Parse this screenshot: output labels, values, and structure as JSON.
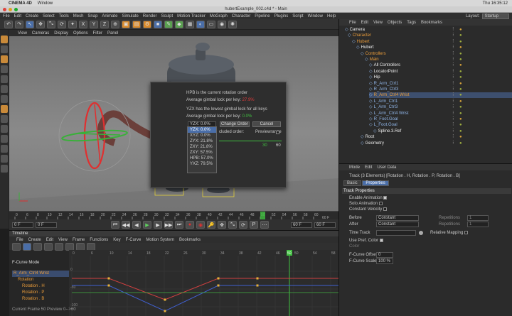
{
  "mac_bar": {
    "app": "CINEMA 4D",
    "menu": "Window",
    "clock": "Thu 16:35:12"
  },
  "title": "hubertExample_002.c4d * - Main",
  "menu": [
    "File",
    "Edit",
    "Create",
    "Select",
    "Tools",
    "Mesh",
    "Snap",
    "Animate",
    "Simulate",
    "Render",
    "Sculpt",
    "Motion Tracker",
    "MoGraph",
    "Character",
    "Pipeline",
    "Plugins",
    "Script",
    "Window",
    "Help"
  ],
  "layout": {
    "label": "Layout:",
    "value": "Startup"
  },
  "viewport_menu": [
    "View",
    "Cameras",
    "Display",
    "Options",
    "Filter",
    "Panel"
  ],
  "popup": {
    "line1": "HPB is the current rotation order",
    "line2_label": "Average gimbal lock per key: ",
    "line2_value": "27.9%",
    "line3": "YZX has the lowest gimbal lock for all keys",
    "line4_label": "Average gimbal lock per key: ",
    "line4_value": "0.0%",
    "select_value": "YZX: 0.0%",
    "change_order": "Change Order",
    "cancel": "Cancel",
    "include_text": "cluded order:",
    "preview_text": "Previewrange",
    "range_a": "30",
    "range_b": "60",
    "options": [
      "YZX: 0.0%",
      "XYZ: 0.0%",
      "ZYX: 21.8%",
      "ZXY: 21.8%",
      "ZXY: 57.5%",
      "HPB: 57.0%",
      "YXZ: 79.5%"
    ]
  },
  "ruler": {
    "ticks": [
      "0",
      "6",
      "8",
      "10",
      "12",
      "14",
      "16",
      "18",
      "20",
      "22",
      "24",
      "26",
      "28",
      "30",
      "32",
      "34",
      "36",
      "38",
      "40",
      "42",
      "44",
      "46",
      "48",
      "50",
      "52",
      "54",
      "56",
      "58",
      "60"
    ],
    "end": "60 F"
  },
  "anim": {
    "current": "0 F",
    "start": "0 F",
    "end": "60 F",
    "max": "60 F"
  },
  "timeline": {
    "title": "Timeline",
    "menu": [
      "File",
      "Create",
      "Edit",
      "View",
      "Frame",
      "Functions",
      "Key",
      "F-Curve",
      "Motion System",
      "Bookmarks"
    ],
    "mode": "F-Curve Mode",
    "tracks": [
      "R_Arm_Ctrl4 Wrist",
      "Rotation",
      "Rotation . H",
      "Rotation . P",
      "Rotation . B"
    ],
    "ticks": [
      "0",
      "6",
      "10",
      "14",
      "18",
      "22",
      "26",
      "30",
      "34",
      "38",
      "42",
      "46",
      "50",
      "54",
      "58"
    ],
    "playhead": "50",
    "yticks": [
      "0",
      "-50",
      "-100"
    ],
    "status": "Current Frame 50  Preview 0-->60"
  },
  "objects": {
    "menu": [
      "File",
      "Edit",
      "View",
      "Objects",
      "Tags",
      "Bookmarks"
    ],
    "items": [
      {
        "name": "Camera",
        "color": "white"
      },
      {
        "name": "Character",
        "color": "orange"
      },
      {
        "name": "Hubert",
        "color": "orange"
      },
      {
        "name": "Hubert",
        "color": "white"
      },
      {
        "name": "Controllers",
        "color": "orange"
      },
      {
        "name": "Main",
        "color": "orange"
      },
      {
        "name": "All Controllers",
        "color": "white"
      },
      {
        "name": "LocatorPoint",
        "color": "white"
      },
      {
        "name": "Hip",
        "color": "white"
      },
      {
        "name": "R_Arm_Ctrl1",
        "color": "blue"
      },
      {
        "name": "R_Arm_Ctrl3",
        "color": "blue"
      },
      {
        "name": "R_Arm_Ctrl4 Wrist",
        "color": "orange"
      },
      {
        "name": "L_Arm_Ctrl1",
        "color": "blue"
      },
      {
        "name": "L_Arm_Ctrl3",
        "color": "blue"
      },
      {
        "name": "L_Arm_Ctrl4 Wrist",
        "color": "blue"
      },
      {
        "name": "R_Foot.Goal",
        "color": "blue"
      },
      {
        "name": "L_Foot.Goal",
        "color": "blue"
      },
      {
        "name": "Spline.3.Ref",
        "color": "white"
      },
      {
        "name": "Root",
        "color": "white"
      },
      {
        "name": "Geometry",
        "color": "white"
      }
    ]
  },
  "attributes": {
    "menu": [
      "Mode",
      "Edit",
      "User Data"
    ],
    "track_title": "Track (3 Elements) [Rotation . H, Rotation . P, Rotation . B]",
    "tabs": [
      "Basic",
      "Properties"
    ],
    "section": "Track Properties",
    "enable_animation": "Enable Animation",
    "solo_animation": "Solo Animation",
    "constant_velocity": "Constant Velocity",
    "before_label": "Before",
    "before_value": "Constant",
    "after_label": "After",
    "after_value": "Constant",
    "repetitions": "Repetitions",
    "rep_value": "1",
    "time_track": "Time Track",
    "relative_mapping": "Relative Mapping",
    "use_pref_color": "Use Pref. Color",
    "color": "Color",
    "fcurve_offset": "F-Curve Offset",
    "fcurve_offset_value": "0",
    "fcurve_scale": "F-Curve Scale",
    "fcurve_scale_value": "100 %"
  }
}
